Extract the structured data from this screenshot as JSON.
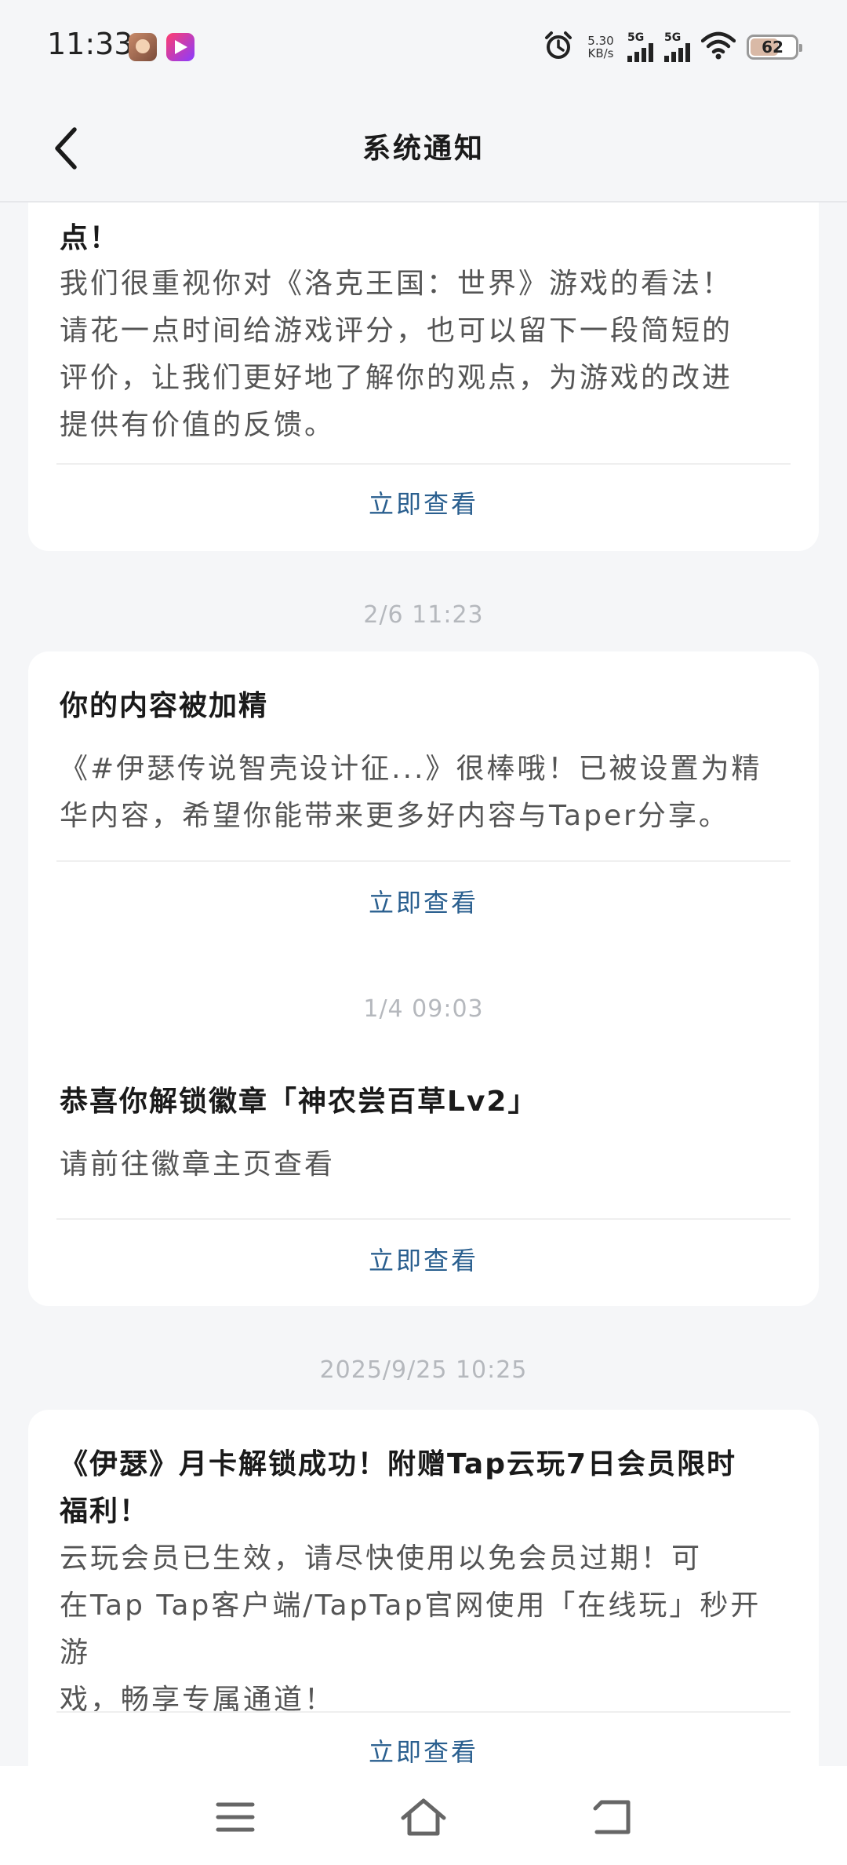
{
  "status_bar": {
    "time": "11:33",
    "net_speed": "5.30",
    "net_speed_unit": "KB/s",
    "signal1": "5G",
    "signal2": "5G",
    "battery": "62"
  },
  "header": {
    "title": "系统通知"
  },
  "notifications": [
    {
      "title": "点！",
      "body": [
        "我们很重视你对《洛克王国：世界》游戏的看法！",
        "请花一点时间给游戏评分，也可以留下一段简短的",
        "评价，让我们更好地了解你的观点，为游戏的改进",
        "提供有价值的反馈。"
      ],
      "action": "立即查看"
    },
    {
      "time": "2/6  11:23",
      "title": "你的内容被加精",
      "body": [
        "《#伊瑟传说智壳设计征...》很棒哦！已被设置为精",
        "华内容，希望你能带来更多好内容与Taper分享。"
      ],
      "action": "立即查看"
    },
    {
      "time": "1/4  09:03",
      "title": "恭喜你解锁徽章「神农尝百草Lv2」",
      "body": [
        "请前往徽章主页查看"
      ],
      "action": "立即查看"
    },
    {
      "time": "2025/9/25  10:25",
      "title": [
        "《伊瑟》月卡解锁成功！附赠Tap云玩7日会员限时",
        "福利！"
      ],
      "body": [
        "云玩会员已生效，请尽快使用以免会员过期！可",
        "在Tap Tap客户端/TapTap官网使用「在线玩」秒开游",
        "戏，畅享专属通道！"
      ],
      "action": "立即查看"
    }
  ],
  "icons": {
    "back": "chevron-left-icon",
    "alarm": "alarm-icon",
    "wifi": "wifi-icon",
    "menu": "menu-icon",
    "home": "home-icon",
    "return": "back-nav-icon"
  },
  "colors": {
    "link": "#2a5f8f",
    "background": "#f5f6f8",
    "timestamp": "#b5b8bd"
  }
}
